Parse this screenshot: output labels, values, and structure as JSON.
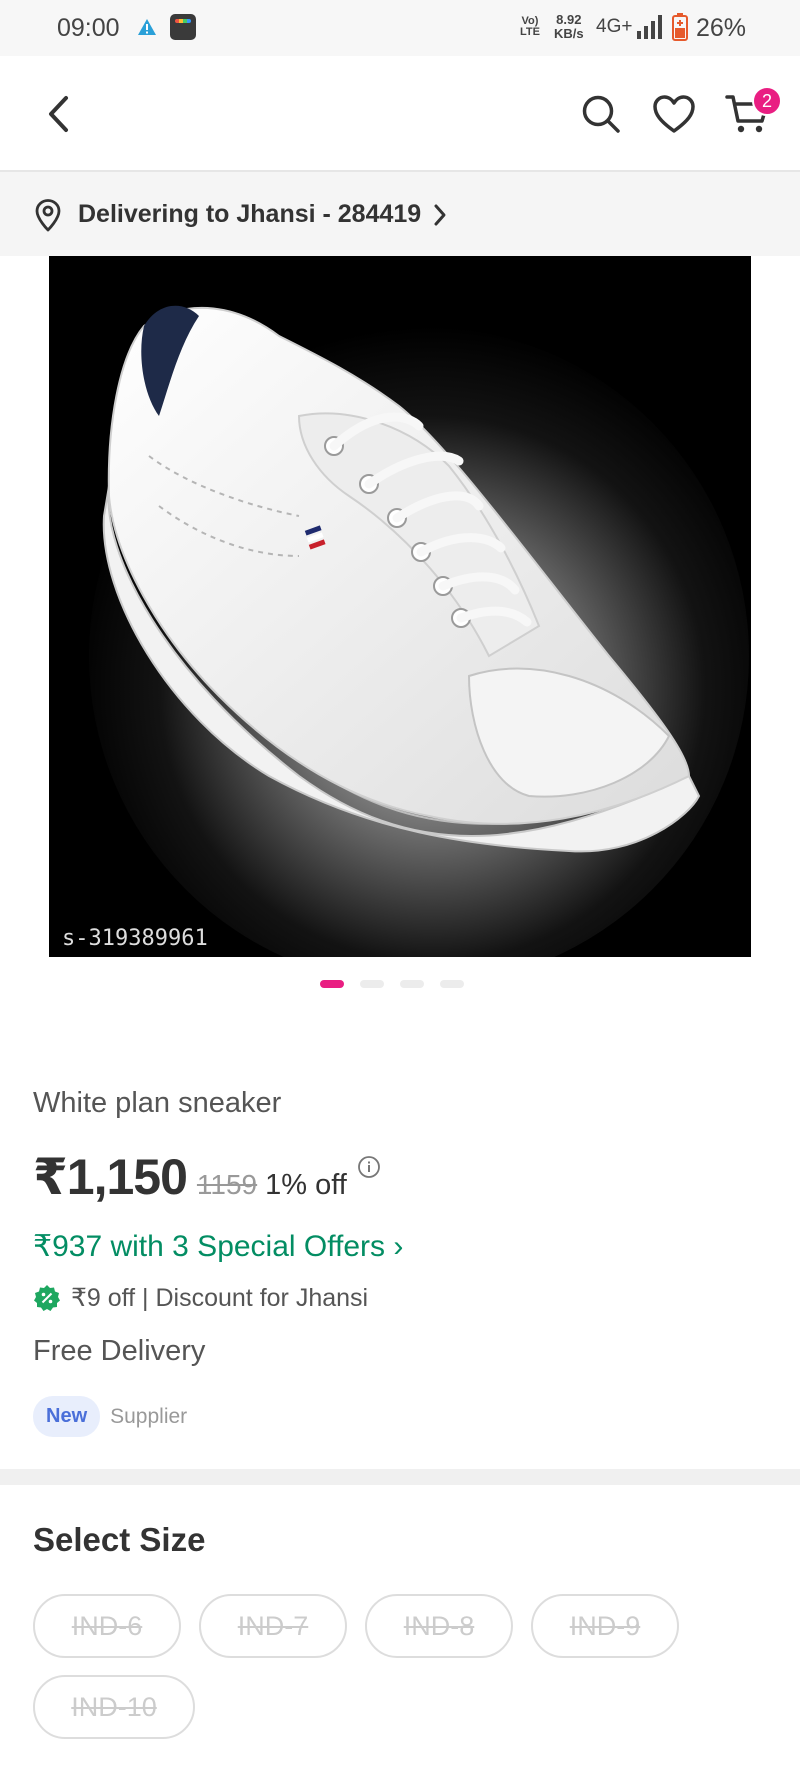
{
  "status_bar": {
    "time": "09:00",
    "volte_line1": "Vo)",
    "volte_line2": "LTE",
    "speed_value": "8.92",
    "speed_unit": "KB/s",
    "network": "4G+",
    "battery": "26%"
  },
  "header": {
    "cart_count": "2"
  },
  "delivery": {
    "text": "Delivering to Jhansi - 284419"
  },
  "product": {
    "image_id": "s-319389961",
    "title": "White plan sneaker",
    "price": "₹1,150",
    "mrp": "1159",
    "discount": "1% off",
    "offers": "₹937 with 3 Special Offers ›",
    "location_discount": "₹9 off | Discount for Jhansi",
    "delivery": "Free Delivery",
    "supplier_badge": "New",
    "supplier_label": "Supplier",
    "carousel_count": 4,
    "carousel_active": 1
  },
  "sizes": {
    "title": "Select Size",
    "options": [
      "IND-6",
      "IND-7",
      "IND-8",
      "IND-9",
      "IND-10"
    ],
    "all_out_of_stock": true
  },
  "colors": {
    "accent": "#e91e82",
    "offer_green": "#038d63",
    "badge_blue": "#4a6fd9"
  }
}
